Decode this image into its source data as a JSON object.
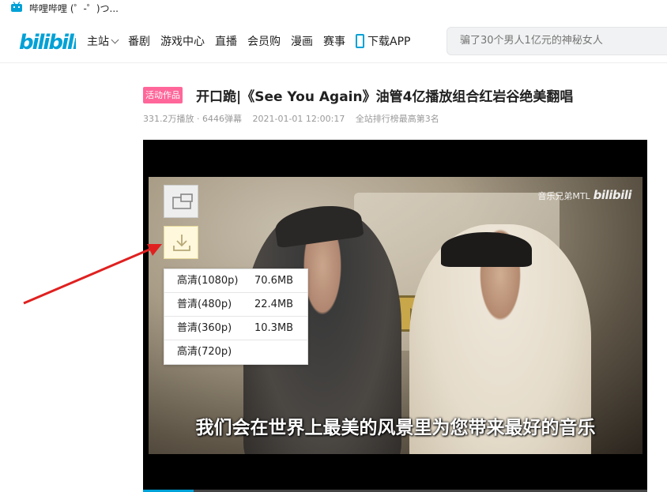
{
  "tab": {
    "title": "哔哩哔哩 (゜-゜)つ..."
  },
  "nav": {
    "items": [
      "主站",
      "番剧",
      "游戏中心",
      "直播",
      "会员购",
      "漫画",
      "赛事",
      "下载APP"
    ]
  },
  "search": {
    "placeholder": "骗了30个男人1亿元的神秘女人"
  },
  "video": {
    "badge": "活动作品",
    "title": "开口跪|《See You Again》油管4亿播放组合红岩谷绝美翻唱",
    "plays": "331.2万播放 · 6446弹幕",
    "date": "2021-01-01 12:00:17",
    "rank": "全站排行榜最高第3名",
    "watermark_text": "音乐兄弟MTL",
    "watermark_logo": "bilibili",
    "subtitle": "我们会在世界上最美的风景里为您带来最好的音乐",
    "progress": 0.1
  },
  "download_menu": [
    {
      "quality": "高清(1080p)",
      "size": "70.6MB"
    },
    {
      "quality": "普清(480p)",
      "size": "22.4MB"
    },
    {
      "quality": "普清(360p)",
      "size": "10.3MB"
    },
    {
      "quality": "高清(720p)",
      "size": ""
    }
  ],
  "colors": {
    "brand": "#00a1d6",
    "badge": "#ff6699",
    "arrow": "#e02020"
  }
}
